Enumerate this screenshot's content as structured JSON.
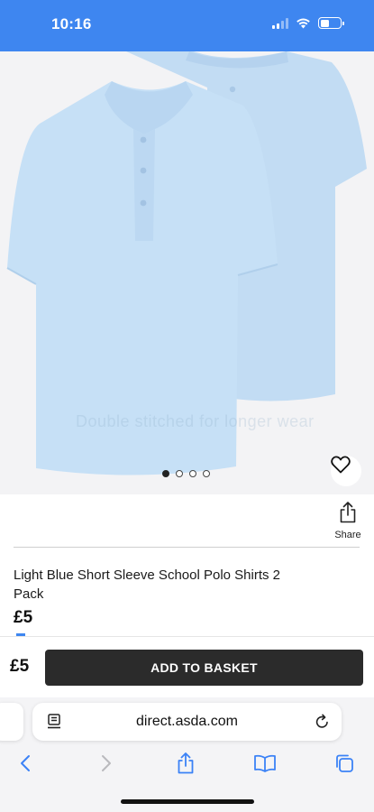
{
  "status_bar": {
    "time": "10:16",
    "icons": [
      "signal-icon",
      "wifi-icon",
      "battery-icon"
    ],
    "background_color": "#3e86f0"
  },
  "gallery": {
    "image": "light-blue-polo-shirts-2-pack",
    "watermark": "Double stitched for longer wear",
    "pagination": {
      "total": 4,
      "active_index": 0
    },
    "favourite_icon": "heart-outline-icon"
  },
  "share": {
    "label": "Share",
    "icon": "share-icon"
  },
  "product": {
    "title": "Light Blue Short Sleeve School Polo Shirts 2 Pack",
    "price": "£5"
  },
  "basket_bar": {
    "price": "£5",
    "button_label": "ADD TO BASKET",
    "button_color": "#2b2b2b"
  },
  "browser": {
    "url": "direct.asda.com",
    "toolbar": [
      "back-icon",
      "forward-icon",
      "share-icon",
      "bookmarks-icon",
      "tabs-icon"
    ]
  }
}
